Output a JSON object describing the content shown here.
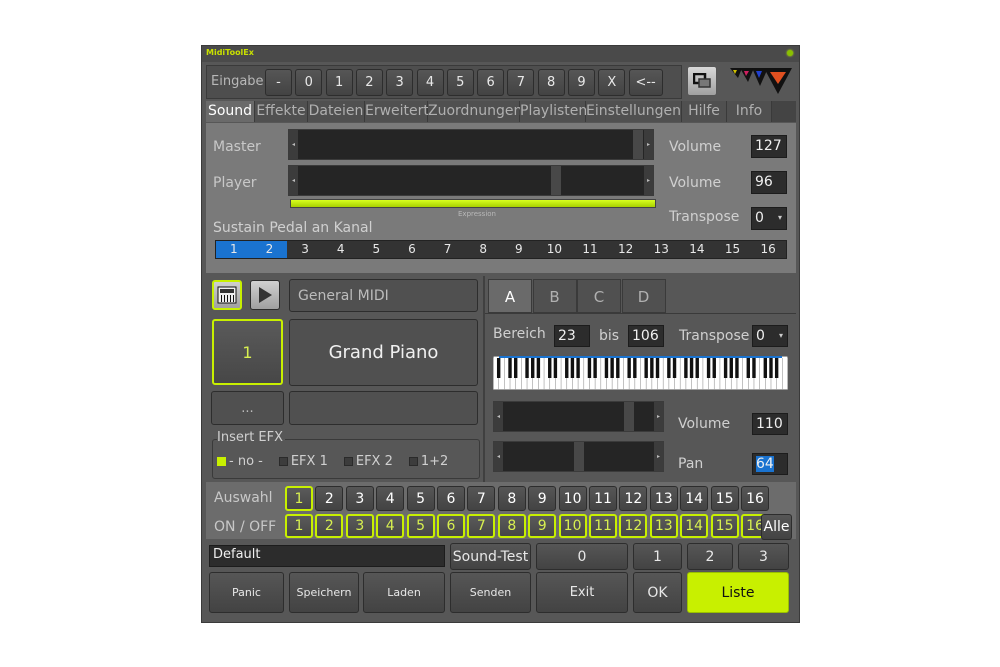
{
  "window": {
    "title": "MidiToolEx"
  },
  "input_bar": {
    "label": "Eingabe",
    "keys": [
      "-",
      "0",
      "1",
      "2",
      "3",
      "4",
      "5",
      "6",
      "7",
      "8",
      "9",
      "X",
      "<--"
    ]
  },
  "tabs": [
    {
      "label": "Sound",
      "active": true
    },
    {
      "label": "Effekte"
    },
    {
      "label": "Dateien"
    },
    {
      "label": "Erweitert"
    },
    {
      "label": "Zuordnungen"
    },
    {
      "label": "Playlisten"
    },
    {
      "label": "Einstellungen"
    },
    {
      "label": "Hilfe"
    },
    {
      "label": "Info"
    }
  ],
  "sound": {
    "master_label": "Master",
    "player_label": "Player",
    "master_volume_label": "Volume",
    "master_volume": "127",
    "player_volume_label": "Volume",
    "player_volume": "96",
    "expression_label": "Expression",
    "expression_fill": 1.0,
    "transpose_label": "Transpose",
    "transpose": "0",
    "sustain_label": "Sustain Pedal an Kanal",
    "sustain_channels": [
      "1",
      "2",
      "3",
      "4",
      "5",
      "6",
      "7",
      "8",
      "9",
      "10",
      "11",
      "12",
      "13",
      "14",
      "15",
      "16"
    ],
    "sustain_active": [
      "1",
      "2"
    ]
  },
  "instrument": {
    "bank": "General MIDI",
    "channel": "1",
    "name": "Grand Piano",
    "more": "...",
    "efx_group": "Insert EFX",
    "efx_options": [
      "- no -",
      "EFX 1",
      "EFX 2",
      "1+2"
    ],
    "efx_selected": "- no -"
  },
  "layer": {
    "tabs": [
      "A",
      "B",
      "C",
      "D"
    ],
    "active_tab": "A",
    "range_label": "Bereich",
    "range_from": "23",
    "bis_label": "bis",
    "range_to": "106",
    "transpose_label": "Transpose",
    "transpose": "0",
    "volume_label": "Volume",
    "volume": "110",
    "pan_label": "Pan",
    "pan": "64"
  },
  "channels": {
    "select_label": "Auswahl",
    "onoff_label": "ON / OFF",
    "numbers": [
      "1",
      "2",
      "3",
      "4",
      "5",
      "6",
      "7",
      "8",
      "9",
      "10",
      "11",
      "12",
      "13",
      "14",
      "15",
      "16"
    ],
    "selected": "1",
    "all_label": "Alle"
  },
  "footer": {
    "preset_name": "Default",
    "sound_test": "Sound-Test",
    "slots": [
      "0",
      "1",
      "2",
      "3"
    ],
    "panic": "Panic",
    "save": "Speichern",
    "load": "Laden",
    "send": "Senden",
    "exit": "Exit",
    "ok": "OK",
    "list": "Liste"
  },
  "colors": {
    "accent": "#c8f000",
    "selection": "#1a73d0",
    "background": "#575757"
  }
}
